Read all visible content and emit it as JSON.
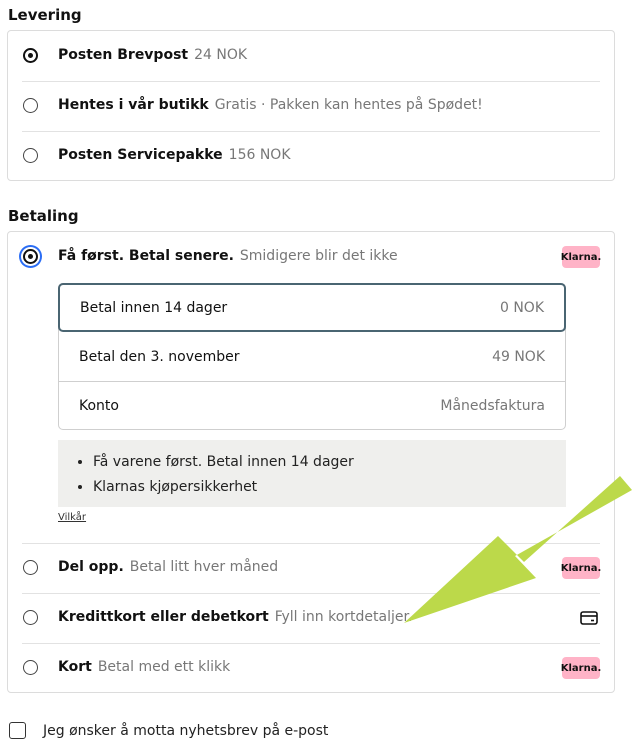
{
  "delivery": {
    "title": "Levering",
    "options": [
      {
        "label": "Posten Brevpost",
        "desc": "24 NOK",
        "selected": true
      },
      {
        "label": "Hentes i vår butikk",
        "desc": "Gratis · Pakken kan hentes på Spødet!",
        "selected": false
      },
      {
        "label": "Posten Servicepakke",
        "desc": "156 NOK",
        "selected": false
      }
    ]
  },
  "payment": {
    "title": "Betaling",
    "klarna_badge": "Klarna.",
    "pay_later": {
      "label": "Få først. Betal senere.",
      "desc": "Smidigere blir det ikke",
      "sub_options": [
        {
          "label": "Betal innen 14 dager",
          "value": "0 NOK",
          "selected": true
        },
        {
          "label": "Betal den 3. november",
          "value": "49 NOK",
          "selected": false
        },
        {
          "label": "Konto",
          "value": "Månedsfaktura",
          "selected": false
        }
      ],
      "info": [
        "Få varene først. Betal innen 14 dager",
        "Klarnas kjøpersikkerhet"
      ],
      "terms_link": "Vilkår"
    },
    "options": [
      {
        "label": "Del opp.",
        "desc": "Betal litt hver måned",
        "badge": "klarna"
      },
      {
        "label": "Kredittkort eller debetkort",
        "desc": "Fyll inn kortdetaljer.",
        "badge": "card-icon"
      },
      {
        "label": "Kort",
        "desc": "Betal med ett klikk",
        "badge": "klarna"
      }
    ]
  },
  "newsletter": {
    "label": "Jeg ønsker å motta nyhetsbrev på e-post",
    "checked": false
  },
  "colors": {
    "klarna_pink": "#ffb3c7",
    "arrow_green": "#bcd94a",
    "selected_border": "#4a6572"
  }
}
